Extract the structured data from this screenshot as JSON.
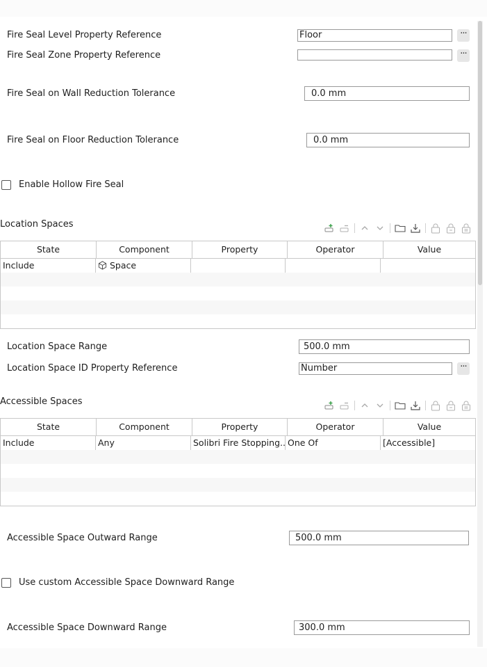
{
  "fields": {
    "level_ref_label": "Fire Seal Level Property Reference",
    "level_ref_value": "Floor",
    "zone_ref_label": "Fire Seal Zone Property Reference",
    "zone_ref_value": "",
    "wall_tol_label": "Fire Seal on Wall Reduction Tolerance",
    "wall_tol_value": "0.0 mm",
    "floor_tol_label": "Fire Seal on Floor Reduction Tolerance",
    "floor_tol_value": "0.0 mm",
    "hollow_label": "Enable Hollow Fire Seal",
    "hollow_checked": false,
    "more_glyph": "···"
  },
  "location": {
    "title": "Location Spaces",
    "columns": [
      "State",
      "Component",
      "Property",
      "Operator",
      "Value"
    ],
    "rows": [
      {
        "state": "Include",
        "component": "Space",
        "component_icon": "cube-icon",
        "property": "",
        "operator": "",
        "value": ""
      }
    ],
    "range_label": "Location Space Range",
    "range_value": "500.0 mm",
    "id_ref_label": "Location Space ID Property Reference",
    "id_ref_value": "Number"
  },
  "accessible": {
    "title": "Accessible Spaces",
    "columns": [
      "State",
      "Component",
      "Property",
      "Operator",
      "Value"
    ],
    "rows": [
      {
        "state": "Include",
        "component": "Any",
        "property": "Solibri Fire Stopping...",
        "operator": "One Of",
        "value": "[Accessible]"
      }
    ],
    "outward_label": "Accessible Space Outward Range",
    "outward_value": "500.0 mm",
    "custom_down_label": "Use custom Accessible Space Downward Range",
    "custom_down_checked": false,
    "down_label": "Accessible Space Downward Range",
    "down_value": "300.0 mm"
  },
  "toolbar_icons": [
    "add-row-icon",
    "remove-row-icon",
    "move-up-icon",
    "move-down-icon",
    "open-folder-icon",
    "import-icon",
    "lock-add-icon",
    "lock-remove-icon",
    "lock-icon"
  ]
}
